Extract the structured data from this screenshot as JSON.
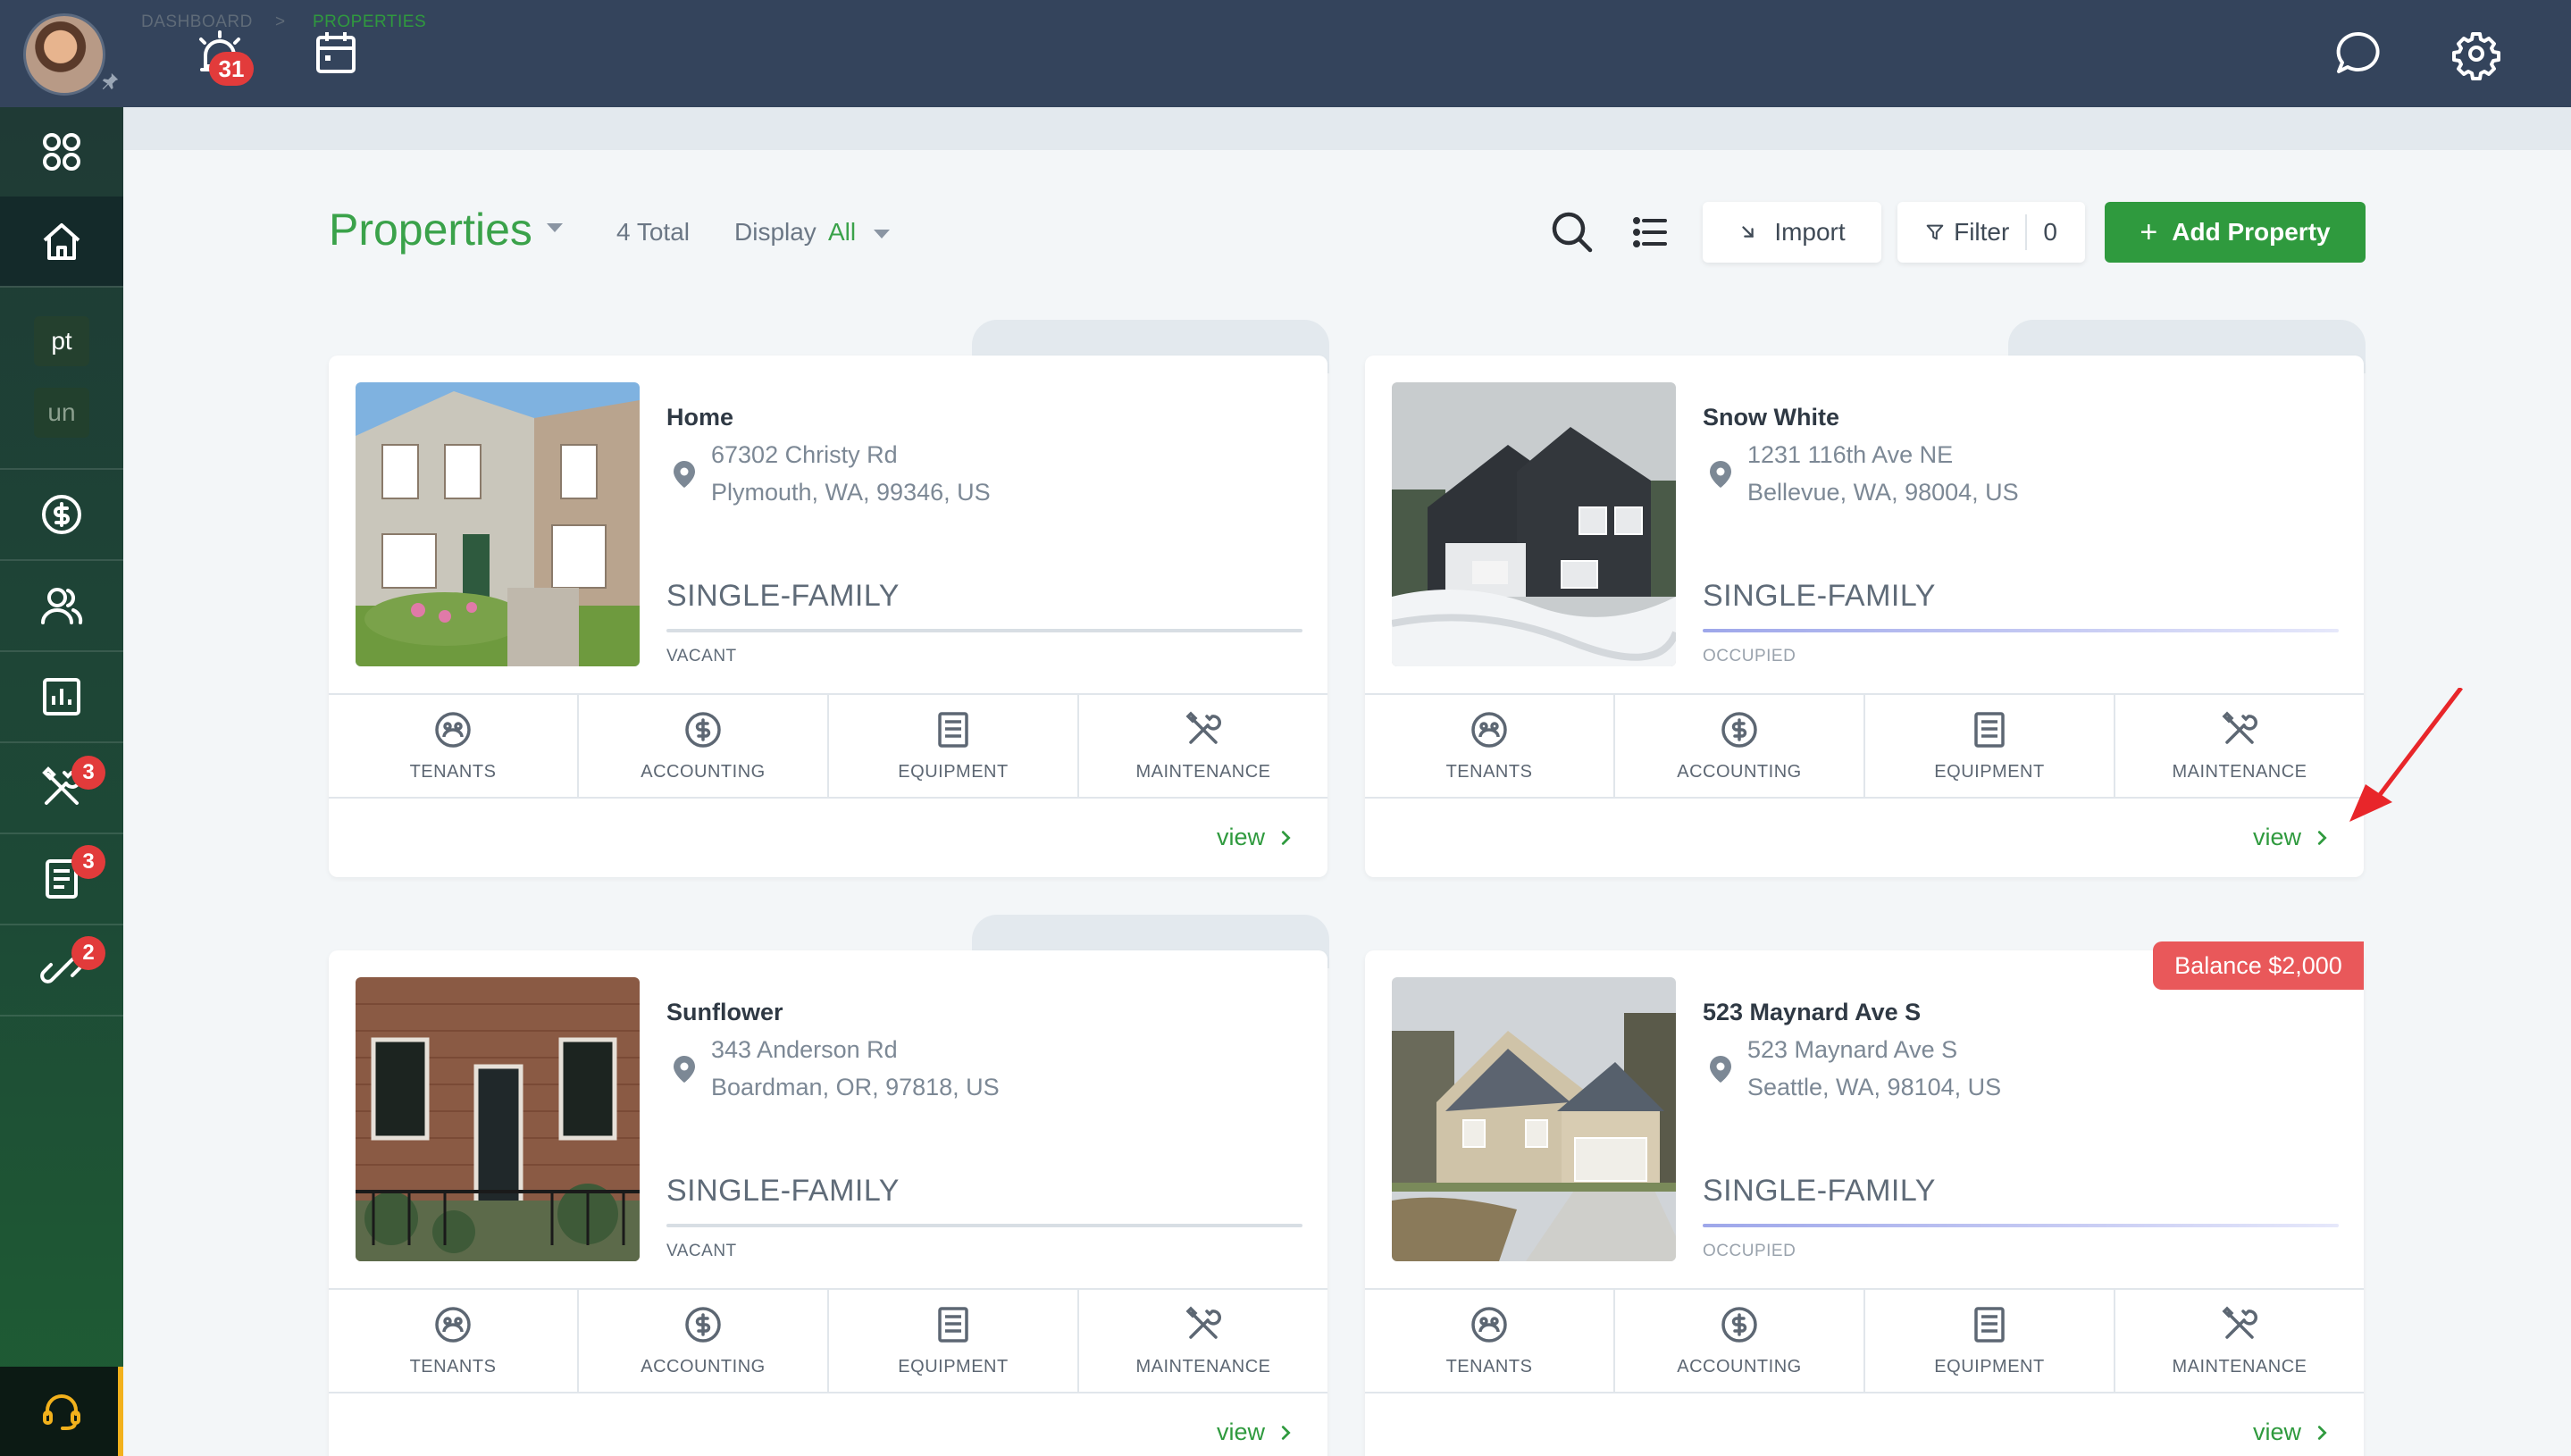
{
  "topbar": {
    "notifications_count": "31"
  },
  "sidebar": {
    "chips": [
      {
        "label": "pt"
      },
      {
        "label": "un"
      }
    ],
    "badges": {
      "maintenance": "3",
      "documents": "3",
      "links": "2"
    }
  },
  "breadcrumb": {
    "dashboard": "DASHBOARD",
    "separator": ">",
    "current": "PROPERTIES"
  },
  "header": {
    "title": "Properties",
    "total": "4 Total",
    "display_label": "Display",
    "display_value": "All",
    "import_label": "Import",
    "filter_label": "Filter",
    "filter_count": "0",
    "add_label": "Add Property"
  },
  "properties": [
    {
      "name": "Home",
      "address1": "67302 Christy Rd",
      "address2": "Plymouth, WA, 99346, US",
      "type": "SINGLE-FAMILY",
      "status": "VACANT",
      "view": "view"
    },
    {
      "name": "Snow White",
      "address1": "1231 116th Ave NE",
      "address2": "Bellevue, WA, 98004, US",
      "type": "SINGLE-FAMILY",
      "status": "OCCUPIED",
      "view": "view"
    },
    {
      "name": "Sunflower",
      "address1": "343 Anderson Rd",
      "address2": "Boardman, OR, 97818, US",
      "type": "SINGLE-FAMILY",
      "status": "VACANT",
      "view": "view"
    },
    {
      "name": "523 Maynard Ave S",
      "address1": "523 Maynard Ave S",
      "address2": "Seattle, WA, 98104, US",
      "type": "SINGLE-FAMILY",
      "status": "OCCUPIED",
      "balance": "Balance $2,000",
      "view": "view"
    }
  ],
  "actions": {
    "tenants": "TENANTS",
    "accounting": "ACCOUNTING",
    "equipment": "EQUIPMENT",
    "maintenance": "MAINTENANCE"
  },
  "colors": {
    "accent": "#2f9a3e",
    "topbar": "#34445c",
    "balance": "#e9585a",
    "badge": "#e23b3b"
  }
}
